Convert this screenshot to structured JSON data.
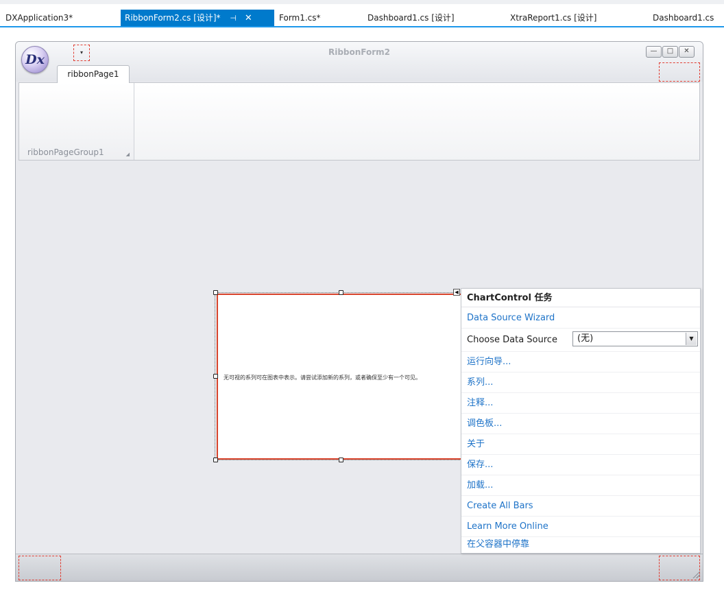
{
  "doc_tabs": [
    {
      "label": "DXApplication3*"
    },
    {
      "label": "RibbonForm2.cs [设计]*",
      "pin": "⊣",
      "close": "✕"
    },
    {
      "label": "Form1.cs*"
    },
    {
      "label": "Dashboard1.cs [设计]"
    },
    {
      "label": "XtraReport1.cs [设计]"
    },
    {
      "label": "Dashboard1.cs"
    }
  ],
  "form": {
    "title": "RibbonForm2",
    "app_button_glyph": "Dx",
    "qat_glyph": "▾",
    "window_buttons": {
      "minimize": "—",
      "maximize": "□",
      "close": "✕"
    }
  },
  "ribbon": {
    "page_label": "ribbonPage1",
    "group_label": "ribbonPageGroup1",
    "group_expander": "◢"
  },
  "chart": {
    "message": "无可视的系列可在图表中表示。请尝试添加新的系列，或者确保至少有一个可见。",
    "smart_tag_glyph": "◀"
  },
  "task_panel": {
    "header": "ChartControl 任务",
    "data_source_wizard": "Data Source Wizard",
    "choose_data_source_label": "Choose Data Source",
    "choose_data_source_value": "(无)",
    "dropdown_glyph": "▼",
    "items": [
      {
        "label": "运行向导..."
      },
      {
        "label": "系列..."
      },
      {
        "label": "注释..."
      },
      {
        "label": "调色板..."
      },
      {
        "label": "关于"
      },
      {
        "label": "保存..."
      },
      {
        "label": "加载..."
      },
      {
        "label": "Create All Bars"
      },
      {
        "label": "Learn More Online"
      },
      {
        "label": "在父容器中停靠"
      }
    ]
  },
  "colors": {
    "accent": "#007acc",
    "link": "#1e73c8",
    "selection_border": "#d9442c",
    "dashed_marker": "#e03c31"
  }
}
